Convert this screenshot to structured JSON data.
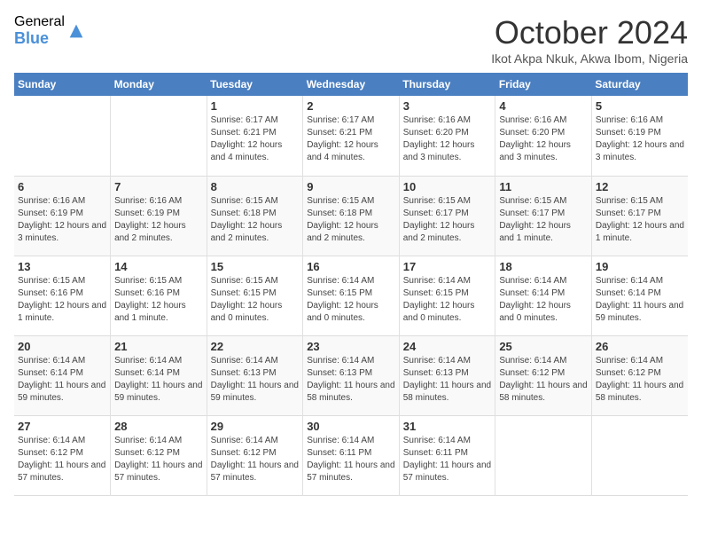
{
  "header": {
    "logo_general": "General",
    "logo_blue": "Blue",
    "title": "October 2024",
    "subtitle": "Ikot Akpa Nkuk, Akwa Ibom, Nigeria"
  },
  "days_of_week": [
    "Sunday",
    "Monday",
    "Tuesday",
    "Wednesday",
    "Thursday",
    "Friday",
    "Saturday"
  ],
  "weeks": [
    [
      {
        "day": "",
        "info": ""
      },
      {
        "day": "",
        "info": ""
      },
      {
        "day": "1",
        "info": "Sunrise: 6:17 AM\nSunset: 6:21 PM\nDaylight: 12 hours and 4 minutes."
      },
      {
        "day": "2",
        "info": "Sunrise: 6:17 AM\nSunset: 6:21 PM\nDaylight: 12 hours and 4 minutes."
      },
      {
        "day": "3",
        "info": "Sunrise: 6:16 AM\nSunset: 6:20 PM\nDaylight: 12 hours and 3 minutes."
      },
      {
        "day": "4",
        "info": "Sunrise: 6:16 AM\nSunset: 6:20 PM\nDaylight: 12 hours and 3 minutes."
      },
      {
        "day": "5",
        "info": "Sunrise: 6:16 AM\nSunset: 6:19 PM\nDaylight: 12 hours and 3 minutes."
      }
    ],
    [
      {
        "day": "6",
        "info": "Sunrise: 6:16 AM\nSunset: 6:19 PM\nDaylight: 12 hours and 3 minutes."
      },
      {
        "day": "7",
        "info": "Sunrise: 6:16 AM\nSunset: 6:19 PM\nDaylight: 12 hours and 2 minutes."
      },
      {
        "day": "8",
        "info": "Sunrise: 6:15 AM\nSunset: 6:18 PM\nDaylight: 12 hours and 2 minutes."
      },
      {
        "day": "9",
        "info": "Sunrise: 6:15 AM\nSunset: 6:18 PM\nDaylight: 12 hours and 2 minutes."
      },
      {
        "day": "10",
        "info": "Sunrise: 6:15 AM\nSunset: 6:17 PM\nDaylight: 12 hours and 2 minutes."
      },
      {
        "day": "11",
        "info": "Sunrise: 6:15 AM\nSunset: 6:17 PM\nDaylight: 12 hours and 1 minute."
      },
      {
        "day": "12",
        "info": "Sunrise: 6:15 AM\nSunset: 6:17 PM\nDaylight: 12 hours and 1 minute."
      }
    ],
    [
      {
        "day": "13",
        "info": "Sunrise: 6:15 AM\nSunset: 6:16 PM\nDaylight: 12 hours and 1 minute."
      },
      {
        "day": "14",
        "info": "Sunrise: 6:15 AM\nSunset: 6:16 PM\nDaylight: 12 hours and 1 minute."
      },
      {
        "day": "15",
        "info": "Sunrise: 6:15 AM\nSunset: 6:15 PM\nDaylight: 12 hours and 0 minutes."
      },
      {
        "day": "16",
        "info": "Sunrise: 6:14 AM\nSunset: 6:15 PM\nDaylight: 12 hours and 0 minutes."
      },
      {
        "day": "17",
        "info": "Sunrise: 6:14 AM\nSunset: 6:15 PM\nDaylight: 12 hours and 0 minutes."
      },
      {
        "day": "18",
        "info": "Sunrise: 6:14 AM\nSunset: 6:14 PM\nDaylight: 12 hours and 0 minutes."
      },
      {
        "day": "19",
        "info": "Sunrise: 6:14 AM\nSunset: 6:14 PM\nDaylight: 11 hours and 59 minutes."
      }
    ],
    [
      {
        "day": "20",
        "info": "Sunrise: 6:14 AM\nSunset: 6:14 PM\nDaylight: 11 hours and 59 minutes."
      },
      {
        "day": "21",
        "info": "Sunrise: 6:14 AM\nSunset: 6:14 PM\nDaylight: 11 hours and 59 minutes."
      },
      {
        "day": "22",
        "info": "Sunrise: 6:14 AM\nSunset: 6:13 PM\nDaylight: 11 hours and 59 minutes."
      },
      {
        "day": "23",
        "info": "Sunrise: 6:14 AM\nSunset: 6:13 PM\nDaylight: 11 hours and 58 minutes."
      },
      {
        "day": "24",
        "info": "Sunrise: 6:14 AM\nSunset: 6:13 PM\nDaylight: 11 hours and 58 minutes."
      },
      {
        "day": "25",
        "info": "Sunrise: 6:14 AM\nSunset: 6:12 PM\nDaylight: 11 hours and 58 minutes."
      },
      {
        "day": "26",
        "info": "Sunrise: 6:14 AM\nSunset: 6:12 PM\nDaylight: 11 hours and 58 minutes."
      }
    ],
    [
      {
        "day": "27",
        "info": "Sunrise: 6:14 AM\nSunset: 6:12 PM\nDaylight: 11 hours and 57 minutes."
      },
      {
        "day": "28",
        "info": "Sunrise: 6:14 AM\nSunset: 6:12 PM\nDaylight: 11 hours and 57 minutes."
      },
      {
        "day": "29",
        "info": "Sunrise: 6:14 AM\nSunset: 6:12 PM\nDaylight: 11 hours and 57 minutes."
      },
      {
        "day": "30",
        "info": "Sunrise: 6:14 AM\nSunset: 6:11 PM\nDaylight: 11 hours and 57 minutes."
      },
      {
        "day": "31",
        "info": "Sunrise: 6:14 AM\nSunset: 6:11 PM\nDaylight: 11 hours and 57 minutes."
      },
      {
        "day": "",
        "info": ""
      },
      {
        "day": "",
        "info": ""
      }
    ]
  ]
}
